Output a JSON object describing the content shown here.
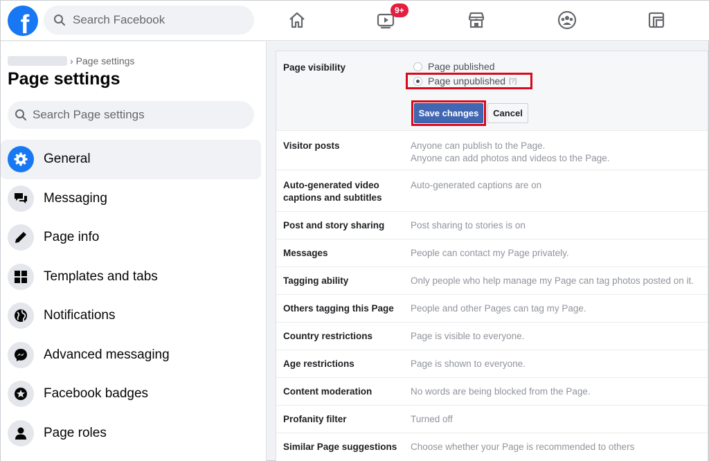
{
  "topbar": {
    "logo_letter": "f",
    "search_placeholder": "Search Facebook",
    "watch_badge": "9+",
    "nav_icons": [
      "home-icon",
      "watch-icon",
      "marketplace-icon",
      "groups-icon",
      "gaming-icon"
    ]
  },
  "sidebar": {
    "breadcrumb_current": "Page settings",
    "title": "Page settings",
    "search_placeholder": "Search Page settings",
    "items": [
      {
        "label": "General",
        "icon": "gear-icon",
        "active": true
      },
      {
        "label": "Messaging",
        "icon": "chat-bubbles-icon"
      },
      {
        "label": "Page info",
        "icon": "pencil-icon"
      },
      {
        "label": "Templates and tabs",
        "icon": "grid-icon"
      },
      {
        "label": "Notifications",
        "icon": "globe-icon"
      },
      {
        "label": "Advanced messaging",
        "icon": "messenger-icon"
      },
      {
        "label": "Facebook badges",
        "icon": "star-badge-icon"
      },
      {
        "label": "Page roles",
        "icon": "person-icon"
      }
    ]
  },
  "settings": {
    "visibility": {
      "label": "Page visibility",
      "option_published": "Page published",
      "option_unpublished": "Page unpublished",
      "help": "[?]",
      "selected": "Page unpublished",
      "save_label": "Save changes",
      "cancel_label": "Cancel"
    },
    "rows": [
      {
        "label": "Visitor posts",
        "value": "Anyone can publish to the Page.",
        "value2": "Anyone can add photos and videos to the Page."
      },
      {
        "label": "Auto-generated video",
        "label2": "captions and subtitles",
        "value": "Auto-generated captions are on"
      },
      {
        "label": "Post and story sharing",
        "value": "Post sharing to stories is on"
      },
      {
        "label": "Messages",
        "value": "People can contact my Page privately."
      },
      {
        "label": "Tagging ability",
        "value": "Only people who help manage my Page can tag photos posted on it."
      },
      {
        "label": "Others tagging this Page",
        "value": "People and other Pages can tag my Page."
      },
      {
        "label": "Country restrictions",
        "value": "Page is visible to everyone."
      },
      {
        "label": "Age restrictions",
        "value": "Page is shown to everyone."
      },
      {
        "label": "Content moderation",
        "value": "No words are being blocked from the Page."
      },
      {
        "label": "Profanity filter",
        "value": "Turned off"
      },
      {
        "label": "Similar Page suggestions",
        "value": "Choose whether your Page is recommended to others"
      }
    ]
  },
  "colors": {
    "brand": "#1877f2",
    "save_button": "#4267b2",
    "highlight": "#d8091b",
    "badge": "#e41e3f"
  }
}
